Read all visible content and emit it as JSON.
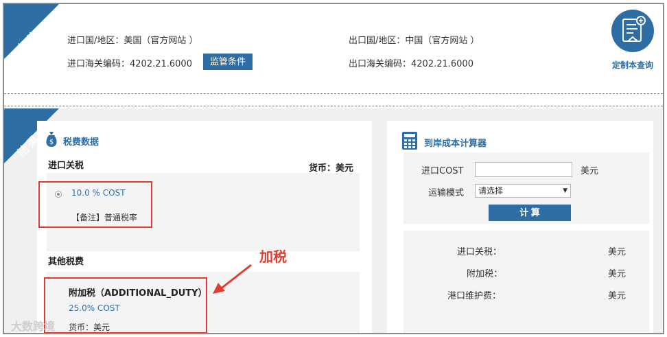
{
  "conditions": {
    "ribbon": "条件",
    "import_country": "进口国/地区：美国（官方网站 ）",
    "import_code": "进口海关编码：4202.21.6000",
    "supervision_btn": "监管条件",
    "export_country": "出口国/地区：中国（官方网站 ）",
    "export_code": "出口海关编码：4202.21.6000",
    "custom_query": "定制本查询"
  },
  "results": {
    "ribbon": "结果",
    "tax_data_title": "税费数据",
    "import_duty_label": "进口关税",
    "currency": "货币：美元",
    "duty_rate": "10.0 % COST",
    "duty_note": "【备注】普通税率",
    "other_taxes_label": "其他税费",
    "additional_duty_title": "附加税（ADDITIONAL_DUTY）",
    "additional_duty_rate": "25.0% COST",
    "additional_currency": "货币：美元",
    "annotation": "加税"
  },
  "calculator": {
    "title": "到岸成本计算器",
    "import_cost_label": "进口COST",
    "import_cost_unit": "美元",
    "transport_label": "运输模式",
    "transport_selected": "请选择",
    "calc_btn": "计 算",
    "rows": [
      {
        "label": "进口关税：",
        "unit": "美元"
      },
      {
        "label": "附加税：",
        "unit": "美元"
      },
      {
        "label": "港口维护费：",
        "unit": "美元"
      }
    ]
  },
  "watermark": "大数跨境",
  "colors": {
    "accent": "#2f6ea5",
    "annotation": "#e23b2e"
  },
  "icons": [
    "money-bag-icon",
    "calculator-icon",
    "certificate-icon",
    "arrow-icon",
    "radio-selected-icon"
  ]
}
